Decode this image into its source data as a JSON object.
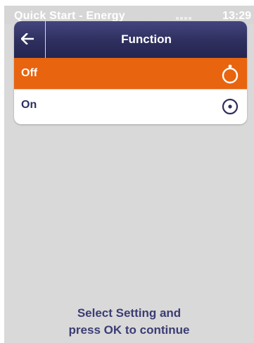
{
  "status_bar": {
    "title": "Quick Start - Energy",
    "time": "13:29"
  },
  "dialog": {
    "title": "Function",
    "back_icon": "arrow-left-icon",
    "options": [
      {
        "label": "Off",
        "selected": true,
        "icon": "radio-empty-icon"
      },
      {
        "label": "On",
        "selected": false,
        "icon": "radio-dot-icon"
      }
    ]
  },
  "footer": {
    "line1": "Select Setting and",
    "line2": "press OK to continue"
  },
  "colors": {
    "header": "#2e2f5e",
    "selected": "#e8640f",
    "background": "#d9d9d9",
    "text_dark": "#3b3d74"
  }
}
